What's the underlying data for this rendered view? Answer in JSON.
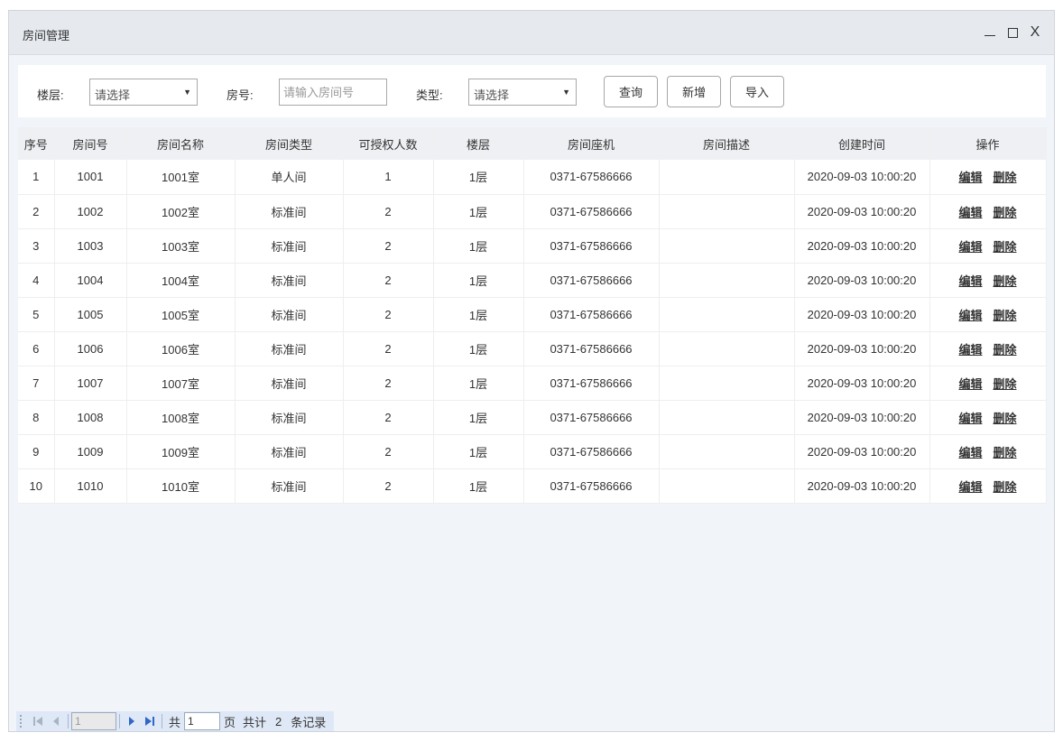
{
  "window": {
    "title": "房间管理",
    "close_label": "X"
  },
  "filters": {
    "floor_label": "楼层:",
    "floor_value": "请选择",
    "room_no_label": "房号:",
    "room_no_placeholder": "请输入房间号",
    "type_label": "类型:",
    "type_value": "请选择",
    "query_btn": "查询",
    "add_btn": "新增",
    "import_btn": "导入"
  },
  "table": {
    "columns": [
      "序号",
      "房间号",
      "房间名称",
      "房间类型",
      "可授权人数",
      "楼层",
      "房间座机",
      "房间描述",
      "创建时间",
      "操作"
    ],
    "edit_label": "编辑",
    "delete_label": "删除",
    "rows": [
      {
        "idx": "1",
        "no": "1001",
        "name": "1001室",
        "type": "单人间",
        "cap": "1",
        "floor": "1层",
        "phone": "0371-67586666",
        "desc": "",
        "created": "2020-09-03 10:00:20"
      },
      {
        "idx": "2",
        "no": "1002",
        "name": "1002室",
        "type": "标准间",
        "cap": "2",
        "floor": "1层",
        "phone": "0371-67586666",
        "desc": "",
        "created": "2020-09-03 10:00:20"
      },
      {
        "idx": "3",
        "no": "1003",
        "name": "1003室",
        "type": "标准间",
        "cap": "2",
        "floor": "1层",
        "phone": "0371-67586666",
        "desc": "",
        "created": "2020-09-03 10:00:20"
      },
      {
        "idx": "4",
        "no": "1004",
        "name": "1004室",
        "type": "标准间",
        "cap": "2",
        "floor": "1层",
        "phone": "0371-67586666",
        "desc": "",
        "created": "2020-09-03 10:00:20"
      },
      {
        "idx": "5",
        "no": "1005",
        "name": "1005室",
        "type": "标准间",
        "cap": "2",
        "floor": "1层",
        "phone": "0371-67586666",
        "desc": "",
        "created": "2020-09-03 10:00:20"
      },
      {
        "idx": "6",
        "no": "1006",
        "name": "1006室",
        "type": "标准间",
        "cap": "2",
        "floor": "1层",
        "phone": "0371-67586666",
        "desc": "",
        "created": "2020-09-03 10:00:20"
      },
      {
        "idx": "7",
        "no": "1007",
        "name": "1007室",
        "type": "标准间",
        "cap": "2",
        "floor": "1层",
        "phone": "0371-67586666",
        "desc": "",
        "created": "2020-09-03 10:00:20"
      },
      {
        "idx": "8",
        "no": "1008",
        "name": "1008室",
        "type": "标准间",
        "cap": "2",
        "floor": "1层",
        "phone": "0371-67586666",
        "desc": "",
        "created": "2020-09-03 10:00:20"
      },
      {
        "idx": "9",
        "no": "1009",
        "name": "1009室",
        "type": "标准间",
        "cap": "2",
        "floor": "1层",
        "phone": "0371-67586666",
        "desc": "",
        "created": "2020-09-03 10:00:20"
      },
      {
        "idx": "10",
        "no": "1010",
        "name": "1010室",
        "type": "标准间",
        "cap": "2",
        "floor": "1层",
        "phone": "0371-67586666",
        "desc": "",
        "created": "2020-09-03 10:00:20"
      }
    ]
  },
  "pager": {
    "current_page": "1",
    "total_pages_prefix": "共",
    "total_pages": "1",
    "page_suffix": "页",
    "total_prefix": "共计",
    "total_records": "2",
    "records_suffix": "条记录",
    "icons": [
      "first-page-icon",
      "prev-page-icon",
      "next-page-icon",
      "last-page-icon"
    ]
  },
  "colors": {
    "titlebar": "#e6eaef",
    "body_bg": "#f1f4f8",
    "header_bg": "#eef0f3",
    "pager_bg": "#dfe8f6",
    "pager_icon_blue": "#2f66c7"
  }
}
